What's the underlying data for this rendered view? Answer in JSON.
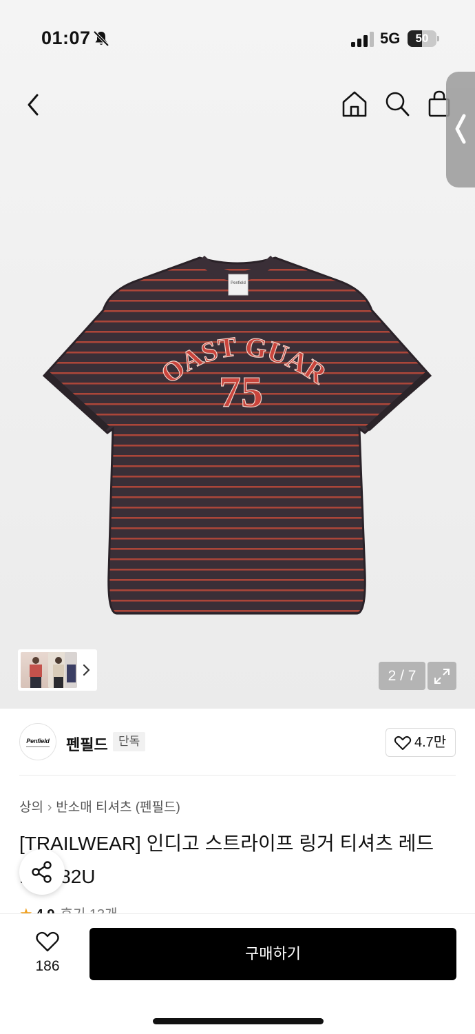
{
  "status_bar": {
    "time": "01:07",
    "network": "5G",
    "battery": "50",
    "battery_level": 0.5,
    "icons": [
      "bell-off-icon",
      "signal-icon",
      "battery-icon"
    ]
  },
  "top_nav": {
    "icons": [
      "back-icon",
      "home-icon",
      "search-icon",
      "cart-icon",
      "edge-panel-handle"
    ]
  },
  "gallery": {
    "counter": "2 / 7",
    "shirt_print_line1": "COAST GUARD",
    "shirt_print_line2": "75",
    "shirt_label": "Penfield",
    "colors": {
      "shirt_base": "#3a2f37",
      "stripe": "#b8493a",
      "print": "#c9443c"
    }
  },
  "brand": {
    "logo_text": "Penfield",
    "name": "펜필드",
    "badge": "단독",
    "likes": "4.7만"
  },
  "product": {
    "breadcrumb": [
      "상의",
      "반소매 티셔츠 (펜필드)"
    ],
    "title": "[TRAILWEAR] 인디고 스트라이프 링거 티셔츠 레드 ...KT82U",
    "rating": "4.9",
    "reviews": "후기 13개"
  },
  "bottom_bar": {
    "wish_count": "186",
    "buy_label": "구매하기",
    "colors": {
      "buy_bg": "#000000",
      "buy_text": "#ffffff"
    }
  }
}
